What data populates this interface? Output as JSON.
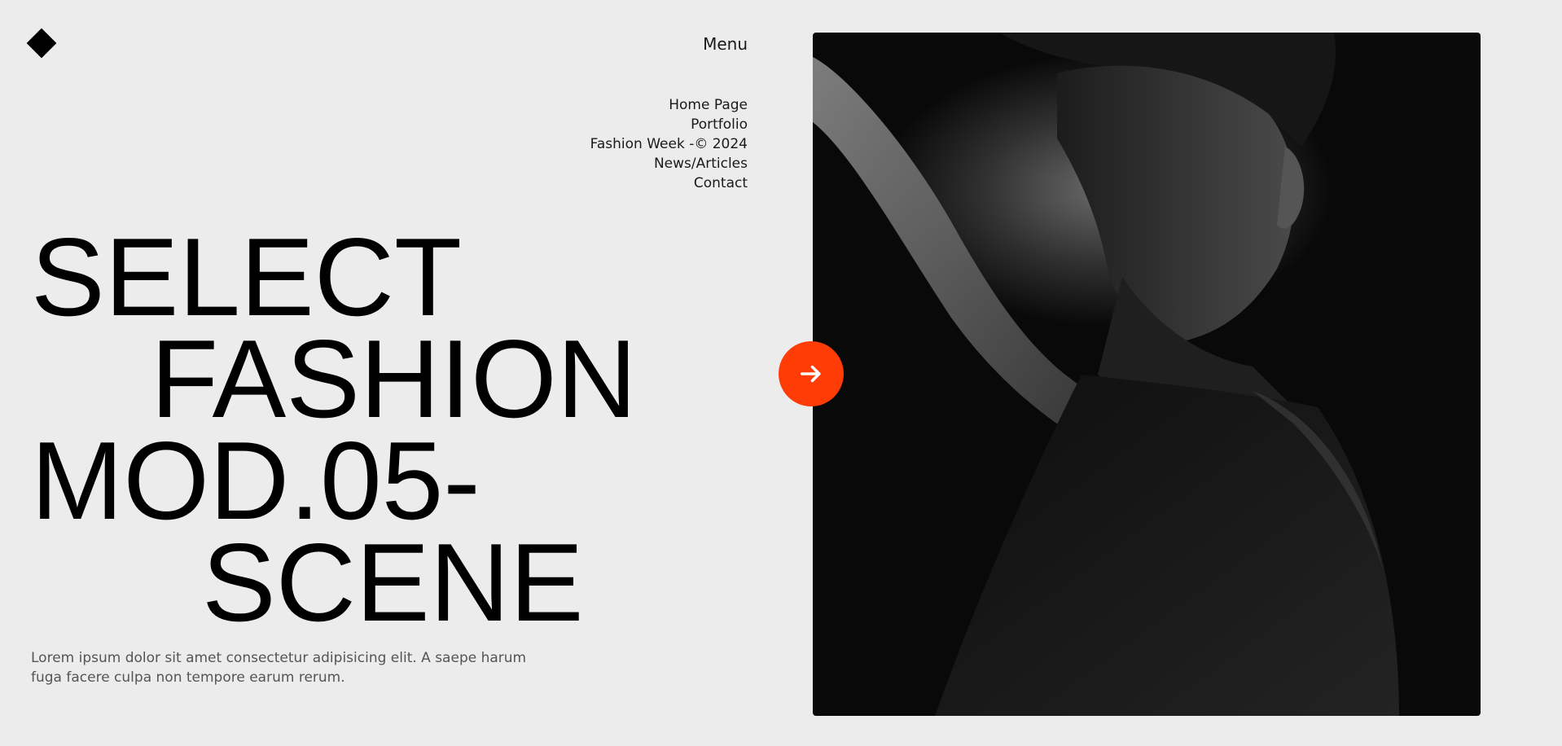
{
  "header": {
    "logo_icon": "diamond-logo-icon",
    "menu_label": "Menu"
  },
  "nav": {
    "items": [
      {
        "label": "Home Page"
      },
      {
        "label": "Portfolio"
      },
      {
        "label": "Fashion Week -© 2024"
      },
      {
        "label": "News/Articles"
      },
      {
        "label": "Contact"
      }
    ]
  },
  "hero": {
    "headline_lines": [
      "SELECT",
      "FASHION",
      "MOD.05-",
      "SCENE"
    ],
    "description": "Lorem ipsum dolor sit amet consectetur adipisicing elit. A saepe harum fuga facere culpa non tempore earum rerum.",
    "next_button_icon": "arrow-right-icon",
    "accent_color": "#ff3c06",
    "image_subject": "black-and-white portrait of a person with raised arm"
  }
}
